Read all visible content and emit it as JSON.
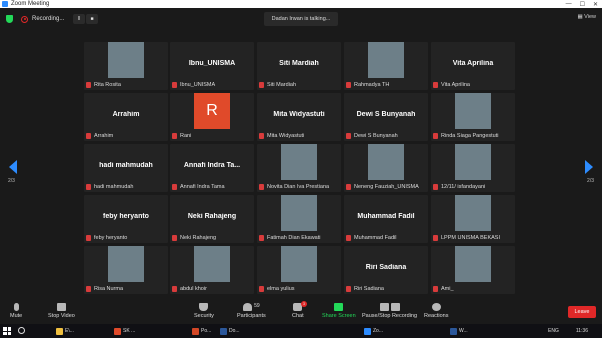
{
  "window": {
    "title": "Zoom Meeting",
    "controls": [
      "—",
      "☐",
      "✕"
    ]
  },
  "meeting_bar": {
    "recording_label": "Recording...",
    "pause_label": "II",
    "stop_label": "■",
    "talking": "Dadan Irwan is talking...",
    "view_label": "View"
  },
  "pager": {
    "left_page": "2/3",
    "right_page": "2/3"
  },
  "tiles": [
    {
      "big": "",
      "label": "Rita Rosita",
      "photo": "photo"
    },
    {
      "big": "Ibnu_UNISMA",
      "label": "Ibnu_UNISMA",
      "photo": ""
    },
    {
      "big": "Siti Mardiah",
      "label": "Siti Mardiah",
      "photo": ""
    },
    {
      "big": "",
      "label": "Rahmadya TH",
      "photo": "photo"
    },
    {
      "big": "Vita Aprilina",
      "label": "Vita Aprilina",
      "photo": ""
    },
    {
      "big": "Arrahim",
      "label": "Arrahim",
      "photo": ""
    },
    {
      "big": "",
      "label": "Rani",
      "photo": "r",
      "initial": "R"
    },
    {
      "big": "Mita Widyastuti",
      "label": "Mita Widyastuti",
      "photo": ""
    },
    {
      "big": "Dewi S Bunyanah",
      "label": "Dewi S Bunyanah",
      "photo": ""
    },
    {
      "big": "",
      "label": "Rinda Siaga Pangestuti",
      "photo": "photo"
    },
    {
      "big": "hadi mahmudah",
      "label": "hadi mahmudah",
      "photo": ""
    },
    {
      "big": "Annafi Indra Ta...",
      "label": "Annafi Indra Tama",
      "photo": ""
    },
    {
      "big": "",
      "label": "Novita Dian Iva Prestiana",
      "photo": "photo"
    },
    {
      "big": "",
      "label": "Neneng Fauziah_UNISMA",
      "photo": "photo"
    },
    {
      "big": "",
      "label": "12/11/ isfandayani",
      "photo": "photo"
    },
    {
      "big": "feby heryanto",
      "label": "feby heryanto",
      "photo": ""
    },
    {
      "big": "Neki Rahajeng",
      "label": "Neki Rahajeng",
      "photo": ""
    },
    {
      "big": "",
      "label": "Fatimah Dian Ekawati",
      "photo": "photo"
    },
    {
      "big": "Muhammad Fadil",
      "label": "Muhammad Fadil",
      "photo": ""
    },
    {
      "big": "",
      "label": "LPPM UNISMA BEKASI",
      "photo": "photo"
    },
    {
      "big": "",
      "label": "Risa Nurma",
      "photo": "photo"
    },
    {
      "big": "",
      "label": "abdul khoir",
      "photo": "photo"
    },
    {
      "big": "",
      "label": "elma yulius",
      "photo": "photo"
    },
    {
      "big": "Riri Sadiana",
      "label": "Riri Sadiana",
      "photo": ""
    },
    {
      "big": "",
      "label": "Ami_",
      "photo": "photo"
    }
  ],
  "toolbar": {
    "mute": "Mute",
    "stop_video": "Stop Video",
    "security": "Security",
    "participants": "Participants",
    "participants_count": "59",
    "chat": "Chat",
    "chat_badge": "3",
    "share_screen": "Share Screen",
    "pause_stop_recording": "Pause/Stop Recording",
    "reactions": "Reactions",
    "leave": "Leave"
  },
  "taskbar": {
    "items": [
      "E\\...",
      "SK ...",
      "Po...",
      "Do...",
      "Zo...",
      "W..."
    ],
    "lang": "ENG",
    "time": "11:36"
  },
  "colors": {
    "accent_green": "#23d959",
    "leave_red": "#e02828",
    "zoom_blue": "#2d8cff",
    "pager_arrow": "#2d8cff"
  }
}
